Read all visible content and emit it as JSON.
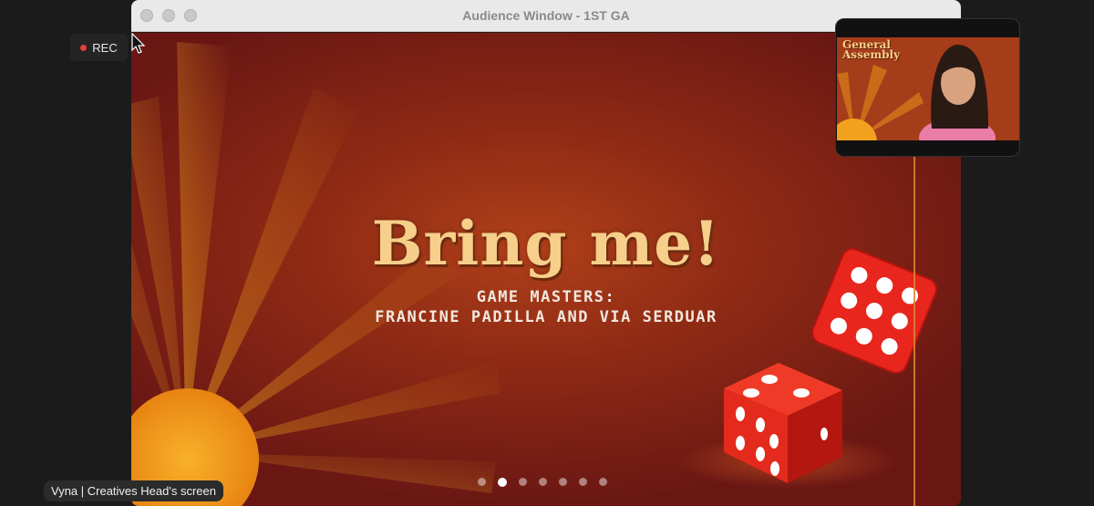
{
  "recording": {
    "label": "REC",
    "indicator_color": "#e0413a"
  },
  "window": {
    "title": "Audience Window - 1ST GA"
  },
  "slide": {
    "headline": "Bring me!",
    "subtitle_line1": "GAME MASTERS:",
    "subtitle_line2": "FRANCINE PADILLA AND VIA SERDUAR",
    "pagination": {
      "total": 7,
      "current": 2
    },
    "colors": {
      "headline": "#f6cf8b",
      "background": "#8e2a14",
      "sun": "#f4a21c",
      "dice": "#e8261d"
    }
  },
  "speaker_thumbnail": {
    "logo_line1": "General",
    "logo_line2": "Assembly"
  },
  "screen_share": {
    "label": "Vyna | Creatives Head's screen"
  }
}
